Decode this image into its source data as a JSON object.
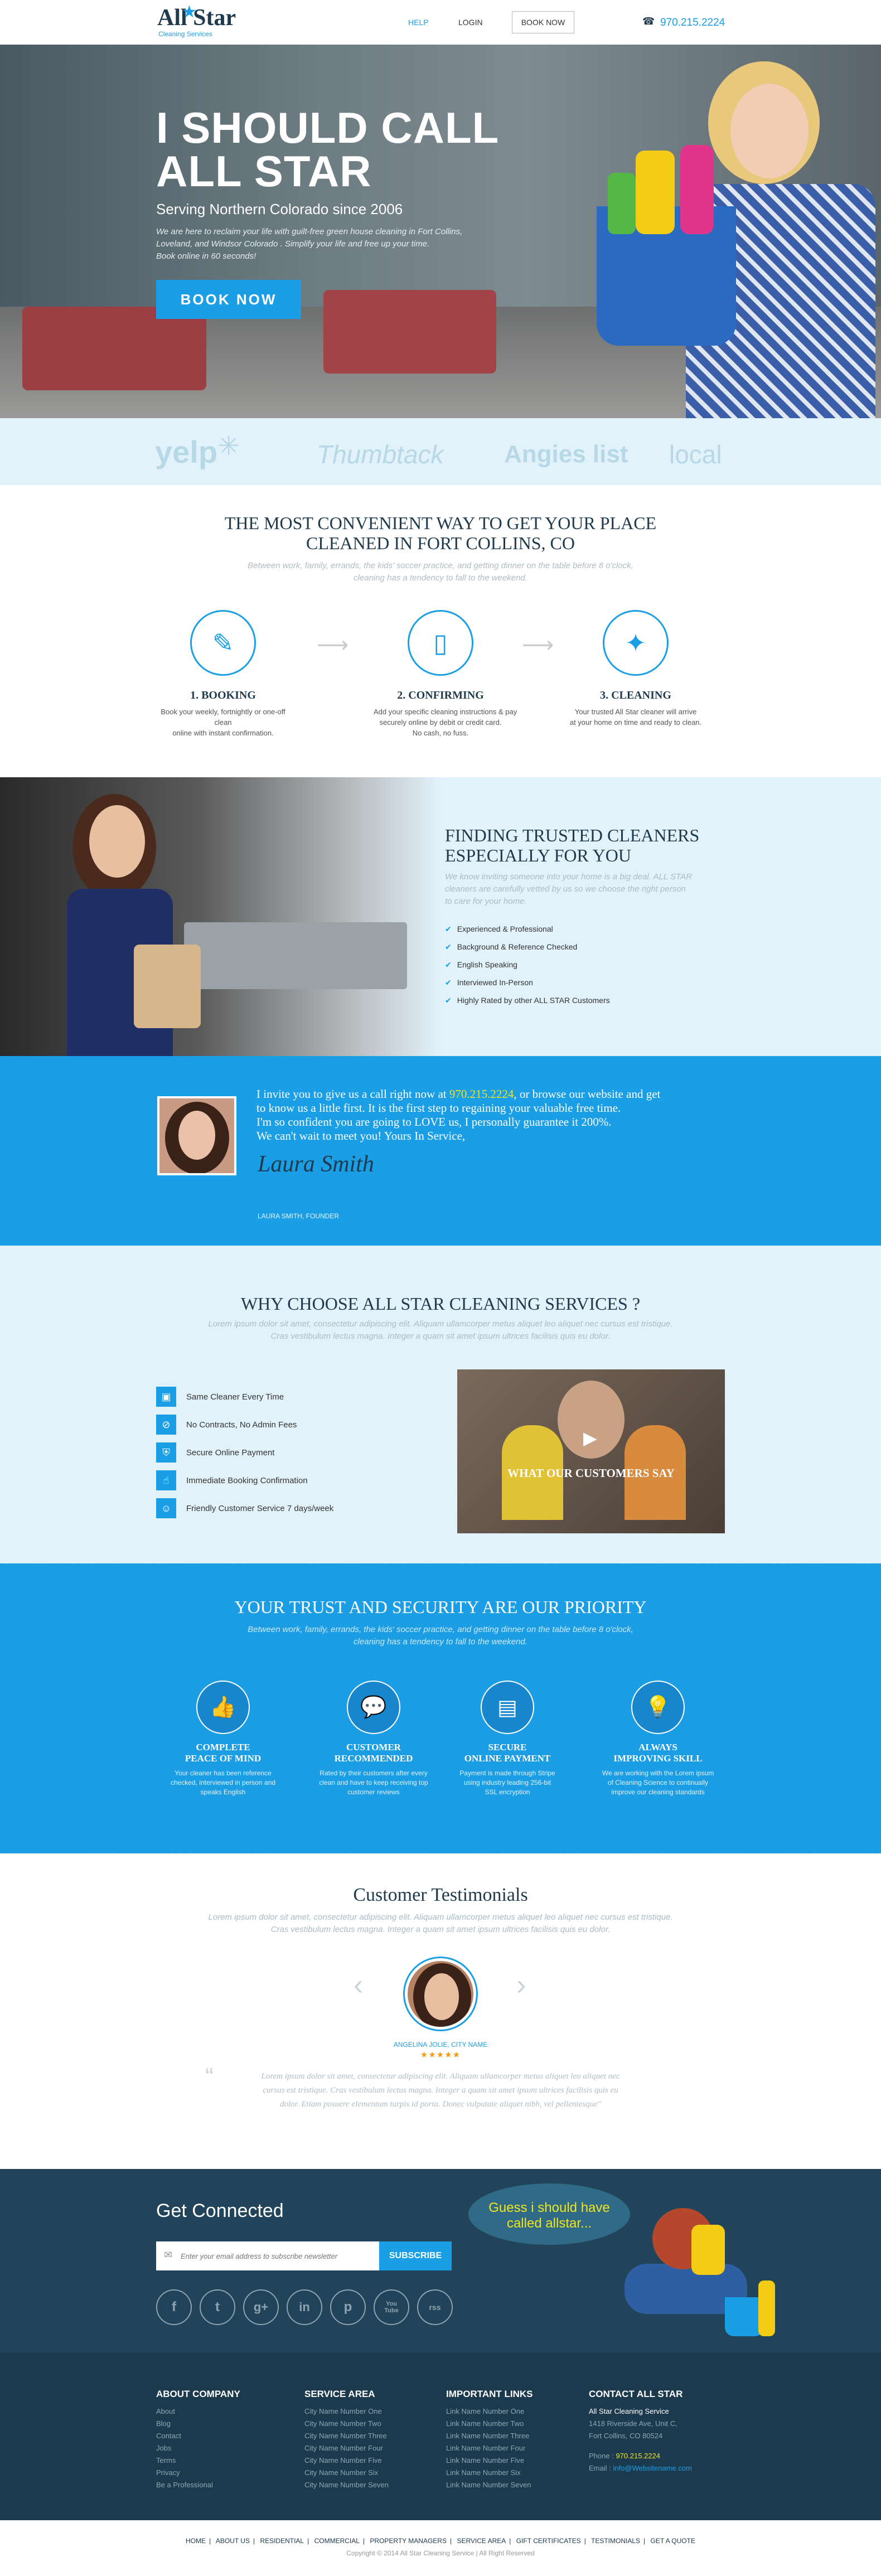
{
  "header": {
    "logo_text": "All Star",
    "logo_sub": "Cleaning Services",
    "help": "HELP",
    "login": "LOGIN",
    "book_now": "BOOK NOW",
    "phone": "970.215.2224"
  },
  "hero": {
    "title_line1": "I SHOULD CALL",
    "title_line2": "ALL STAR",
    "subtitle": "Serving Northern Colorado since 2006",
    "desc_line1": "We are here to reclaim your life with guilt-free green house cleaning in Fort Collins,",
    "desc_line2": "Loveland, and Windsor Colorado . Simplify your life and free up your time.",
    "desc_line3": "Book online in 60 seconds!",
    "cta": "BOOK NOW"
  },
  "partners": [
    "yelp",
    "Thumbtack",
    "Angies list",
    "local"
  ],
  "convenient": {
    "title_line1": "THE MOST CONVENIENT WAY TO GET YOUR PLACE",
    "title_line2": "CLEANED IN FORT COLLINS, CO",
    "sub_line1": "Between work, family, errands, the kids' soccer practice, and getting dinner on the table before 8 o'clock,",
    "sub_line2": "cleaning has a tendency to fall to the weekend.",
    "steps": [
      {
        "title": "1. BOOKING",
        "line1": "Book your weekly, fortnightly or one-off clean",
        "line2": "online with instant confirmation.",
        "line3": ""
      },
      {
        "title": "2. CONFIRMING",
        "line1": "Add your specific cleaning instructions & pay",
        "line2": "securely online by debit or credit card.",
        "line3": "No cash, no fuss."
      },
      {
        "title": "3. CLEANING",
        "line1": "Your trusted All Star cleaner will arrive",
        "line2": "at your home on time and ready to clean.",
        "line3": ""
      }
    ]
  },
  "trusted": {
    "title_line1": "FINDING TRUSTED CLEANERS",
    "title_line2": "ESPECIALLY FOR YOU",
    "sub_line1": "We know inviting someone into your home is a big deal. ALL STAR",
    "sub_line2": "cleaners are carefully vetted by us so we choose the right person",
    "sub_line3": "to care for your home.",
    "items": [
      "Experienced & Professional",
      "Background & Reference Checked",
      "English Speaking",
      "Interviewed In-Person",
      "Highly Rated by other ALL STAR Customers"
    ]
  },
  "founder": {
    "line1a": "I invite you to give us a call right now at ",
    "phone": "970.215.2224",
    "line1b": ", or browse our website and get",
    "line2": "to know us a little first. It is the first step to regaining your valuable free time.",
    "line3": "I'm so confident you are going to LOVE us, I personally guarantee it 200%.",
    "line4": "We can't wait to meet you! Yours In Service,",
    "signature": "Laura Smith",
    "name": "LAURA SMITH, FOUNDER"
  },
  "why": {
    "title": "WHY CHOOSE ALL STAR CLEANING SERVICES ?",
    "sub_line1": "Lorem ipsum dolor sit amet, consectetur adipiscing elit. Aliquam ullamcorper metus aliquet leo aliquet nec cursus est tristique.",
    "sub_line2": "Cras vestibulum lectus magna. Integer a quam sit amet ipsum ultrices facilisis quis eu dolor.",
    "items": [
      "Same Cleaner Every Time",
      "No Contracts, No Admin Fees",
      "Secure Online Payment",
      "Immediate Booking Confirmation",
      "Friendly Customer Service 7 days/week"
    ],
    "video_label": "WHAT OUR CUSTOMERS SAY"
  },
  "security": {
    "title": "YOUR TRUST AND SECURITY ARE OUR PRIORITY",
    "sub_line1": "Between work, family, errands, the kids' soccer practice, and getting dinner on the table before 8 o'clock,",
    "sub_line2": "cleaning has a tendency to fall to the weekend.",
    "items": [
      {
        "t1": "COMPLETE",
        "t2": "PEACE OF MIND",
        "d1": "Your cleaner has been reference",
        "d2": "checked, interviewed in person and",
        "d3": "speaks English"
      },
      {
        "t1": "CUSTOMER",
        "t2": "RECOMMENDED",
        "d1": "Rated by their customers after every",
        "d2": "clean and have to keep receiving top",
        "d3": "customer reviews"
      },
      {
        "t1": "SECURE",
        "t2": "ONLINE PAYMENT",
        "d1": "Payment is made through Stripe",
        "d2": "using industry leading 256-bit",
        "d3": "SSL encryption"
      },
      {
        "t1": "ALWAYS",
        "t2": "IMPROVING SKILL",
        "d1": "We are working with the Lorem ipsum",
        "d2": "of Cleaning Science to continually",
        "d3": "improve our cleaning standards"
      }
    ]
  },
  "testimonials": {
    "title": "Customer Testimonials",
    "sub_line1": "Lorem ipsum dolor sit amet, consectetur adipiscing elit. Aliquam ullamcorper metus aliquet leo aliquet nec cursus est tristique.",
    "sub_line2": "Cras vestibulum lectus magna. Integer a quam sit amet ipsum ultrices facilisis quis eu dolor.",
    "person": "ANGELINA JOLIE, CITY NAME",
    "stars": "★★★★★",
    "quote_line1": "Lorem ipsum dolor sit amet, consectetur adipiscing elit. Aliquam ullamcorper metus aliquet leo aliquet nec",
    "quote_line2": "cursus est tristique. Cras vestibulum lectus magna. Integer a quam sit amet ipsum ultrices facilisis quis eu",
    "quote_line3": "dolor. Etiam posuere elementum turpis id porta. Donec vulputate aliquet nibh, vel pellentesque\""
  },
  "connected": {
    "title": "Get Connected",
    "placeholder": "Enter your email address to subscribe newsletter",
    "subscribe": "SUBSCRIBE",
    "bubble_line1": "Guess i should have",
    "bubble_line2": "called allstar...",
    "social": [
      "f",
      "t",
      "g+",
      "in",
      "p",
      "You Tube",
      "rss"
    ]
  },
  "footer": {
    "col1": {
      "title": "ABOUT COMPANY",
      "links": [
        "About",
        "Blog",
        "Contact",
        "Jobs",
        "Terms",
        "Privacy",
        "Be a Professional"
      ]
    },
    "col2": {
      "title": "SERVICE AREA",
      "links": [
        "City Name Number One",
        "City Name Number Two",
        "City Name Number Three",
        "City Name Number Four",
        "City Name Number Five",
        "City Name Number Six",
        "City Name Number Seven"
      ]
    },
    "col3": {
      "title": "IMPORTANT LINKS",
      "links": [
        "Link Name Number One",
        "Link Name Number Two",
        "Link Name Number Three",
        "Link Name Number Four",
        "Link Name Number Five",
        "Link Name Number Six",
        "Link Name Number Seven"
      ]
    },
    "col4": {
      "title": "CONTACT ALL STAR",
      "company": "All Star Cleaning Service",
      "addr1": "1418 Riverside Ave, Unit C,",
      "addr2": "Fort Collins, CO 80524",
      "phone_label": "Phone : ",
      "phone": "970.215.2224",
      "email_label": "Email : ",
      "email": "info@Websitename.com"
    }
  },
  "bottom": {
    "links": [
      "HOME",
      "ABOUT US",
      "RESIDENTIAL",
      "COMMERCIAL",
      "PROPERTY MANAGERS",
      "SERVICE AREA",
      "GIFT CERTIFICATES",
      "TESTIMONIALS",
      "GET A QUOTE"
    ],
    "copyright": "Copyright © 2014 All Star Cleaning Service  |  All Right Reserved"
  },
  "colors": {
    "accent": "#1a9fe6",
    "dark": "#1e3a4c",
    "light_bg": "#e2f2fa",
    "yellow": "#f2e41d"
  }
}
